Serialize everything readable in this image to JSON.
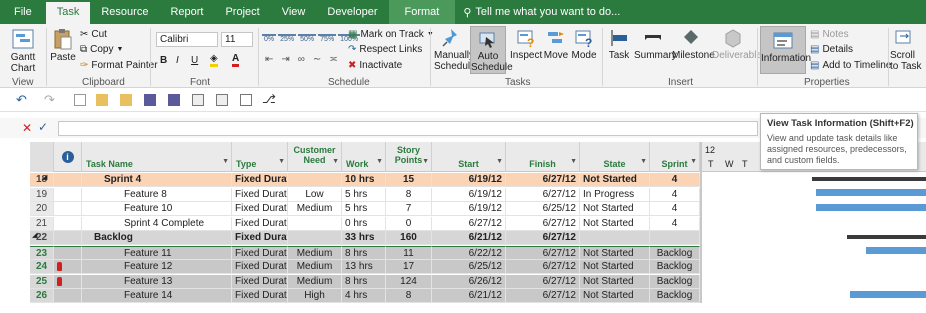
{
  "tabs": [
    "File",
    "Task",
    "Resource",
    "Report",
    "Project",
    "View",
    "Developer",
    "Format"
  ],
  "tell_me": "Tell me what you want to do...",
  "ribbon": {
    "gantt_chart": "Gantt Chart",
    "paste": "Paste",
    "cut": "Cut",
    "copy": "Copy",
    "format_painter": "Format Painter",
    "font_name": "Calibri",
    "font_size": "11",
    "bold": "B",
    "italic": "I",
    "underline": "U",
    "pct": [
      "0%",
      "25%",
      "50%",
      "75%",
      "100%"
    ],
    "mark_on_track": "Mark on Track",
    "respect_links": "Respect Links",
    "inactivate": "Inactivate",
    "manually_schedule": "Manually Schedule",
    "auto_schedule": "Auto Schedule",
    "inspect": "Inspect",
    "move": "Move",
    "mode": "Mode",
    "task": "Task",
    "summary": "Summary",
    "milestone": "Milestone",
    "deliverable": "Deliverable",
    "information": "Information",
    "notes": "Notes",
    "details": "Details",
    "add_to_timeline": "Add to Timeline",
    "scroll_to_task": "Scroll to Task",
    "groups": [
      "View",
      "Clipboard",
      "Font",
      "Schedule",
      "Tasks",
      "Insert",
      "Properties"
    ]
  },
  "tooltip": {
    "title": "View Task Information (Shift+F2)",
    "body": "View and update task details like assigned resources, predecessors, and custom fields."
  },
  "columns": {
    "info": "i",
    "task_name": "Task Name",
    "type": "Type",
    "customer_need": "Customer Need",
    "work": "Work",
    "story_points": "Story Points",
    "start": "Start",
    "finish": "Finish",
    "state": "State",
    "sprint": "Sprint"
  },
  "gantt_header": {
    "top": "12",
    "days": [
      "T",
      "W",
      "T"
    ]
  },
  "rows": [
    {
      "id": "18",
      "name": "Sprint 4",
      "type": "Fixed Durati",
      "need": "",
      "work": "10 hrs",
      "points": "15",
      "start": "6/19/12",
      "finish": "6/27/12",
      "state": "Not Started",
      "sprint": "4"
    },
    {
      "id": "19",
      "name": "Feature 8",
      "type": "Fixed Durati",
      "need": "Low",
      "work": "5 hrs",
      "points": "8",
      "start": "6/19/12",
      "finish": "6/27/12",
      "state": "In Progress",
      "sprint": "4"
    },
    {
      "id": "20",
      "name": "Feature 10",
      "type": "Fixed Durati",
      "need": "Medium",
      "work": "5 hrs",
      "points": "7",
      "start": "6/19/12",
      "finish": "6/25/12",
      "state": "Not Started",
      "sprint": "4"
    },
    {
      "id": "21",
      "name": "Sprint 4 Complete",
      "type": "Fixed Durati",
      "need": "",
      "work": "0 hrs",
      "points": "0",
      "start": "6/27/12",
      "finish": "6/27/12",
      "state": "Not Started",
      "sprint": "4"
    },
    {
      "id": "22",
      "name": "Backlog",
      "type": "Fixed Durati",
      "need": "",
      "work": "33 hrs",
      "points": "160",
      "start": "6/21/12",
      "finish": "6/27/12",
      "state": "",
      "sprint": ""
    },
    {
      "id": "23",
      "name": "Feature 11",
      "type": "Fixed Durati",
      "need": "Medium",
      "work": "8 hrs",
      "points": "11",
      "start": "6/22/12",
      "finish": "6/27/12",
      "state": "Not Started",
      "sprint": "Backlog"
    },
    {
      "id": "24",
      "name": "Feature 12",
      "type": "Fixed Durati",
      "need": "Medium",
      "work": "13 hrs",
      "points": "17",
      "start": "6/25/12",
      "finish": "6/27/12",
      "state": "Not Started",
      "sprint": "Backlog"
    },
    {
      "id": "25",
      "name": "Feature 13",
      "type": "Fixed Durati",
      "need": "Medium",
      "work": "8 hrs",
      "points": "124",
      "start": "6/26/12",
      "finish": "6/27/12",
      "state": "Not Started",
      "sprint": "Backlog"
    },
    {
      "id": "26",
      "name": "Feature 14",
      "type": "Fixed Durati",
      "need": "High",
      "work": "4 hrs",
      "points": "8",
      "start": "6/21/12",
      "finish": "6/27/12",
      "state": "Not Started",
      "sprint": "Backlog"
    }
  ],
  "colors": {
    "accent": "#2b7a3e",
    "summary_row": "#fbd3b5",
    "gantt_bar": "#5b9bd5",
    "indicator": "#d02020"
  }
}
